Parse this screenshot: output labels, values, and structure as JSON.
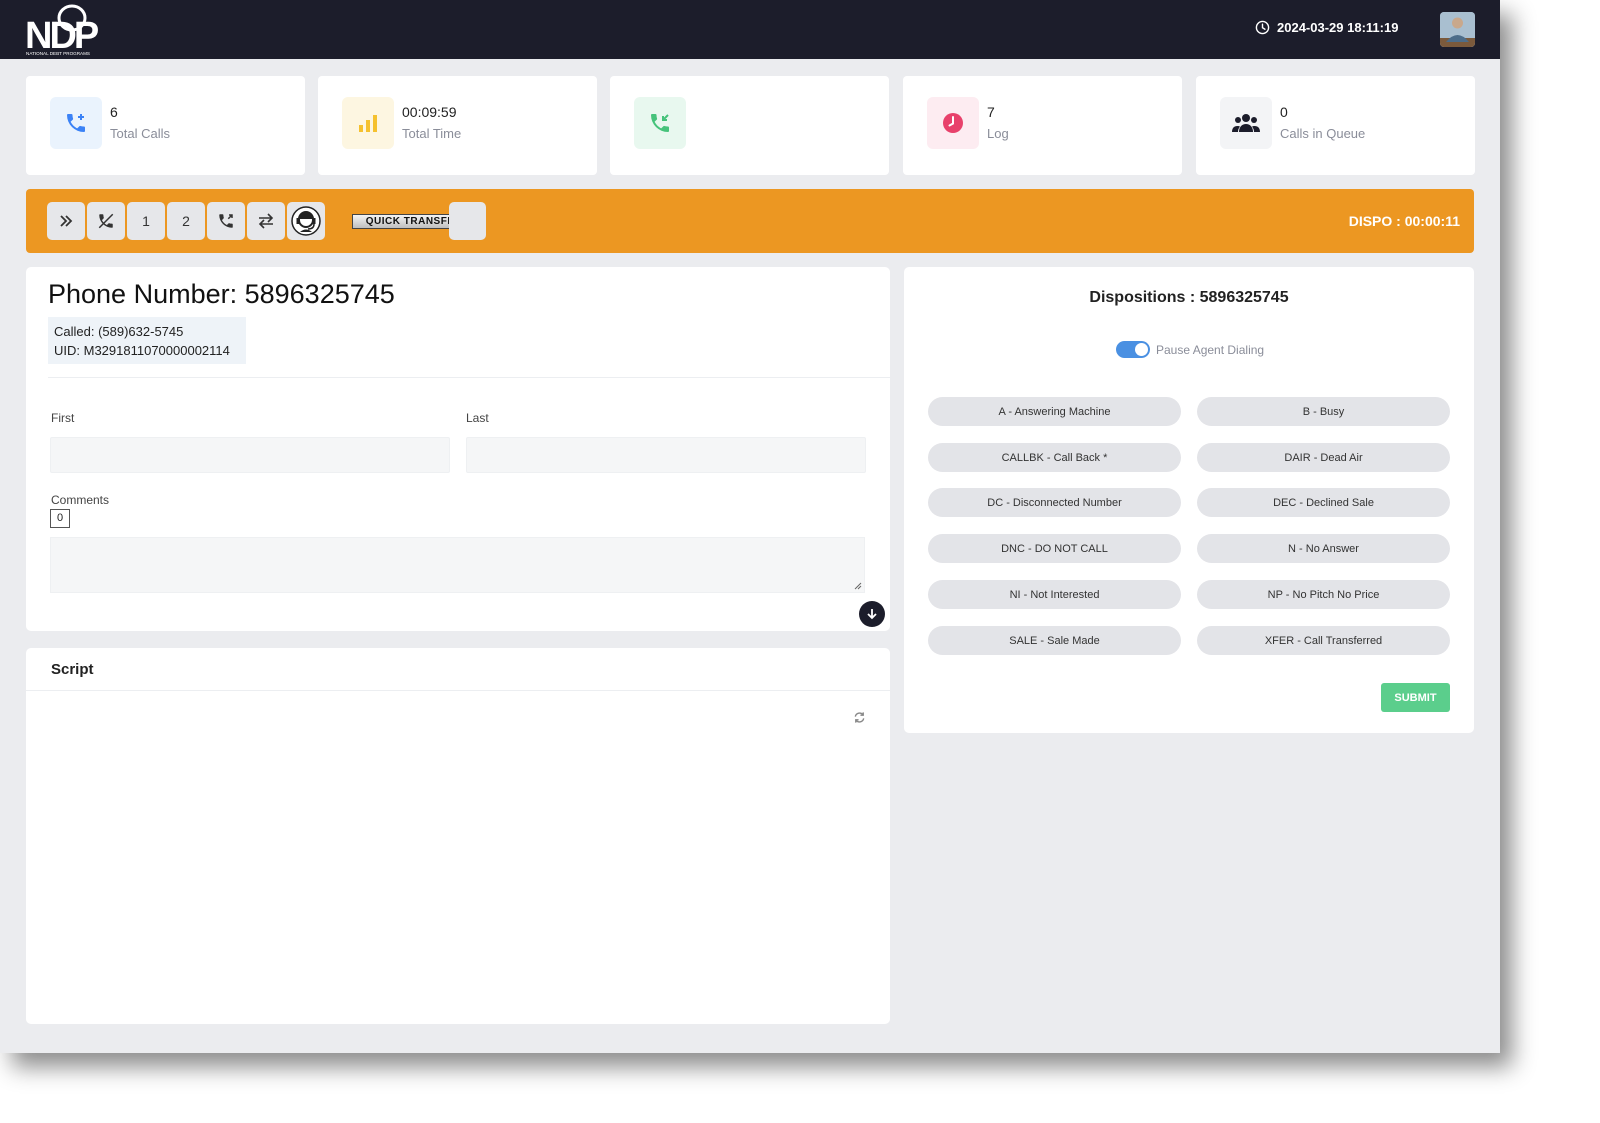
{
  "header": {
    "logo_text": "NDP",
    "logo_subtext": "NATIONAL DEBT PROGRAMS",
    "datetime": "2024-03-29 18:11:19"
  },
  "stats": [
    {
      "icon": "phone-plus-icon",
      "value": "6",
      "label": "Total Calls",
      "color": "#3b82f6",
      "bg": "#eaf3fd"
    },
    {
      "icon": "bar-chart-icon",
      "value": "00:09:59",
      "label": "Total Time",
      "color": "#f5c12e",
      "bg": "#fdf6e1"
    },
    {
      "icon": "phone-incoming-icon",
      "value": "",
      "label": "",
      "color": "#46c37b",
      "bg": "#e8f8ef"
    },
    {
      "icon": "clock-icon",
      "value": "7",
      "label": "Log",
      "color": "#e8416b",
      "bg": "#fdecf1"
    },
    {
      "icon": "users-icon",
      "value": "0",
      "label": "Calls in Queue",
      "color": "#1c1d2b",
      "bg": "#f3f4f6"
    }
  ],
  "toolbar": {
    "btn_1": "1",
    "btn_2": "2",
    "quick_transfer": "QUICK TRANSFER",
    "dispo_timer": "DISPO : 00:00:11",
    "bg_color": "#ec9722"
  },
  "lead": {
    "phone_title": "Phone Number: 5896325745",
    "called": "Called: (589)632-5745",
    "uid": "UID: M3291811070000002114",
    "first_label": "First",
    "first_value": "",
    "last_label": "Last",
    "last_value": "",
    "comments_label": "Comments",
    "comments_count": "0",
    "comments_value": ""
  },
  "script": {
    "title": "Script"
  },
  "dispositions": {
    "title": "Dispositions : 5896325745",
    "pause_label": "Pause Agent Dialing",
    "pause_on": true,
    "options": [
      "A - Answering Machine",
      "B - Busy",
      "CALLBK - Call Back  *",
      "DAIR - Dead Air",
      "DC - Disconnected Number",
      "DEC - Declined Sale",
      "DNC - DO NOT CALL",
      "N - No Answer",
      "NI - Not Interested",
      "NP - No Pitch No Price",
      "SALE - Sale Made",
      "XFER - Call Transferred"
    ],
    "submit_label": "SUBMIT",
    "submit_color": "#5bce8c"
  }
}
